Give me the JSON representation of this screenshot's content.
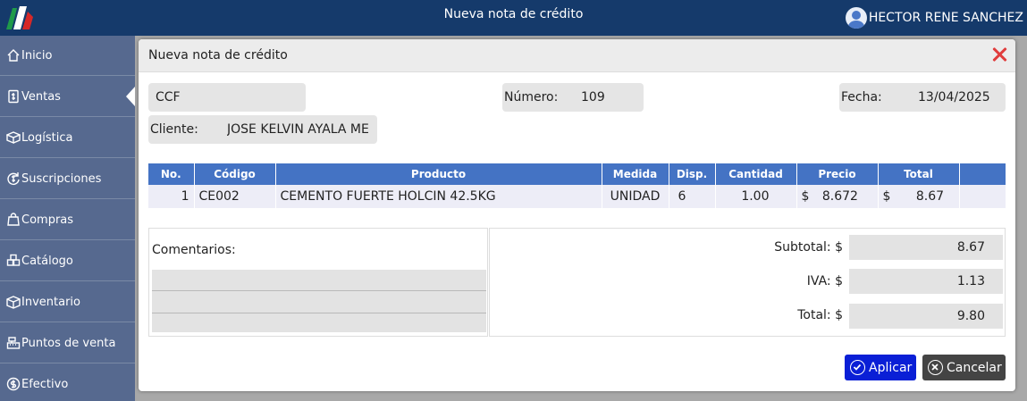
{
  "app": {
    "title": "Nueva nota de crédito",
    "user_name": "HECTOR RENE SANCHEZ"
  },
  "sidebar": {
    "items": [
      {
        "label": "Inicio",
        "icon": "home-icon"
      },
      {
        "label": "Ventas",
        "icon": "receipt-icon",
        "active": true
      },
      {
        "label": "Logística",
        "icon": "truck-icon"
      },
      {
        "label": "Suscripciones",
        "icon": "refresh-dollar-icon"
      },
      {
        "label": "Compras",
        "icon": "shopping-bag-icon"
      },
      {
        "label": "Catálogo",
        "icon": "boxes-icon"
      },
      {
        "label": "Inventario",
        "icon": "box-icon"
      },
      {
        "label": "Puntos de venta",
        "icon": "cash-register-icon"
      },
      {
        "label": "Efectivo",
        "icon": "dollar-circle-icon"
      }
    ]
  },
  "modal": {
    "title": "Nueva nota de crédito",
    "doc_type": "CCF",
    "numero_label": "Número:",
    "numero_value": "109",
    "fecha_label": "Fecha:",
    "fecha_value": "13/04/2025",
    "cliente_label": "Cliente:",
    "cliente_value": "JOSE KELVIN AYALA ME"
  },
  "table": {
    "headers": [
      "No.",
      "Código",
      "Producto",
      "Medida",
      "Disp.",
      "Cantidad",
      "Precio",
      "Total",
      ""
    ],
    "rows": [
      {
        "no": "1",
        "codigo": "CE002",
        "producto": "CEMENTO FUERTE HOLCIN 42.5KG",
        "medida": "UNIDAD",
        "disp": "6",
        "cantidad": "1.00",
        "precio_currency": "$",
        "precio": "8.672",
        "total_currency": "$",
        "total": "8.67"
      }
    ]
  },
  "comments": {
    "label": "Comentarios:"
  },
  "totals": {
    "subtotal_label": "Subtotal: $",
    "subtotal_value": "8.67",
    "iva_label": "IVA: $",
    "iva_value": "1.13",
    "total_label": "Total: $",
    "total_value": "9.80"
  },
  "buttons": {
    "apply_label": "Aplicar",
    "cancel_label": "Cancelar"
  },
  "colors": {
    "topbar": "#153a6b",
    "sidebar": "#56698f",
    "table_header": "#4473c4",
    "apply_button": "#0a1fd6",
    "cancel_button": "#444444",
    "close_icon": "#e03c3c"
  }
}
